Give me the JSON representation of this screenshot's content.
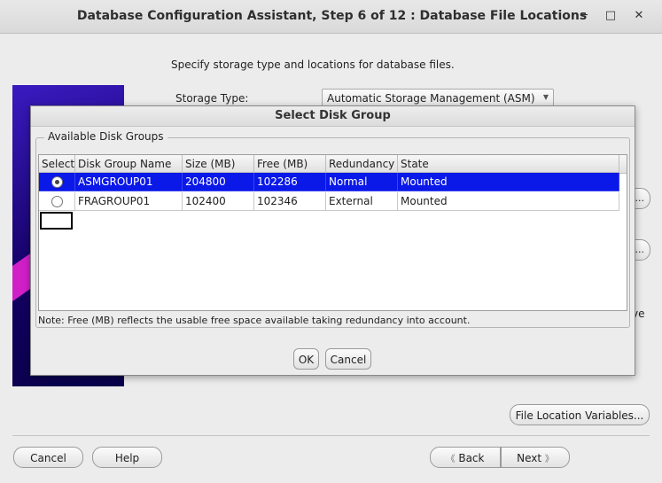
{
  "window": {
    "title": "Database Configuration Assistant, Step 6 of 12 : Database File Locations",
    "minimize": "─",
    "maximize": "□",
    "close": "✕"
  },
  "main": {
    "description": "Specify storage type and locations for database files.",
    "storage_type_label": "Storage Type:",
    "storage_type_value": "Automatic Storage Management (ASM)",
    "browse1_label": "...",
    "browse2_label": "...",
    "partial_text": "ve",
    "file_location_variables_label": "File Location Variables..."
  },
  "footer": {
    "cancel_label": "Cancel",
    "help_label": "Help",
    "back_label": "Back",
    "next_label": "Next",
    "back_icon": "《",
    "next_icon": "》"
  },
  "dialog": {
    "title": "Select Disk Group",
    "group_label": "Available Disk Groups",
    "columns": [
      "Select",
      "Disk Group Name",
      "Size (MB)",
      "Free (MB)",
      "Redundancy",
      "State"
    ],
    "rows": [
      {
        "name": "ASMGROUP01",
        "size": "204800",
        "free": "102286",
        "redundancy": "Normal",
        "state": "Mounted",
        "selected": true
      },
      {
        "name": "FRAGROUP01",
        "size": "102400",
        "free": "102346",
        "redundancy": "External",
        "state": "Mounted",
        "selected": false
      }
    ],
    "note": "Note:  Free (MB) reflects the usable free space available taking redundancy into account.",
    "ok_label": "OK",
    "cancel_label": "Cancel"
  },
  "colors": {
    "selection": "#0a18e8",
    "sidebar": "#120060",
    "accent_stripe": "#d11fc8"
  }
}
